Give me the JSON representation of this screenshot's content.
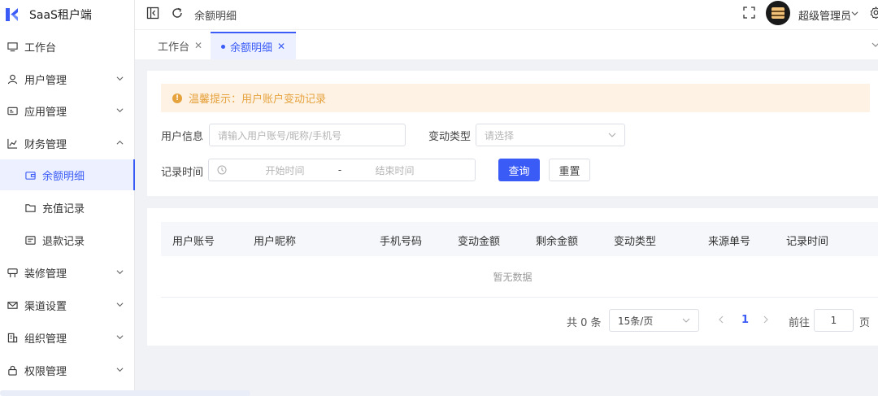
{
  "app": {
    "title": "SaaS租户端"
  },
  "sidebar": {
    "items": [
      {
        "label": "工作台",
        "icon": "monitor-icon"
      },
      {
        "label": "用户管理",
        "icon": "user-icon"
      },
      {
        "label": "应用管理",
        "icon": "app-card-icon"
      },
      {
        "label": "财务管理",
        "icon": "chart-icon"
      },
      {
        "label": "余额明细",
        "icon": "wallet-icon"
      },
      {
        "label": "充值记录",
        "icon": "folder-icon"
      },
      {
        "label": "退款记录",
        "icon": "receipt-icon"
      },
      {
        "label": "装修管理",
        "icon": "decor-icon"
      },
      {
        "label": "渠道设置",
        "icon": "mail-icon"
      },
      {
        "label": "组织管理",
        "icon": "building-icon"
      },
      {
        "label": "权限管理",
        "icon": "lock-icon"
      }
    ],
    "active": "余额明细"
  },
  "header": {
    "breadcrumb": "余额明细",
    "user_name": "超级管理员"
  },
  "tabs": [
    {
      "label": "工作台",
      "close": "✕"
    },
    {
      "label": "余额明细",
      "close": "✕"
    }
  ],
  "search": {
    "alert": "温馨提示：用户账户变动记录",
    "user_info_label": "用户信息",
    "user_info_placeholder": "请输入用户账号/昵称/手机号",
    "change_type_label": "变动类型",
    "change_type_placeholder": "请选择",
    "record_time_label": "记录时间",
    "start_placeholder": "开始时间",
    "range_separator": "-",
    "end_placeholder": "结束时间",
    "query_button": "查询",
    "reset_button": "重置"
  },
  "table": {
    "columns": [
      "用户账号",
      "用户昵称",
      "手机号码",
      "变动金额",
      "剩余金额",
      "变动类型",
      "来源单号",
      "记录时间"
    ],
    "rows": [],
    "empty_text": "暂无数据"
  },
  "pagination": {
    "total_text": "共 0 条",
    "page_size": "15条/页",
    "current_page": "1",
    "goto_label": "前往",
    "goto_value": "1",
    "page_unit": "页"
  },
  "colors": {
    "primary": "#3b5bf6",
    "warning": "#e6a23c",
    "alert_bg": "#fdf2e4",
    "page_bg": "#f0f2f5"
  }
}
